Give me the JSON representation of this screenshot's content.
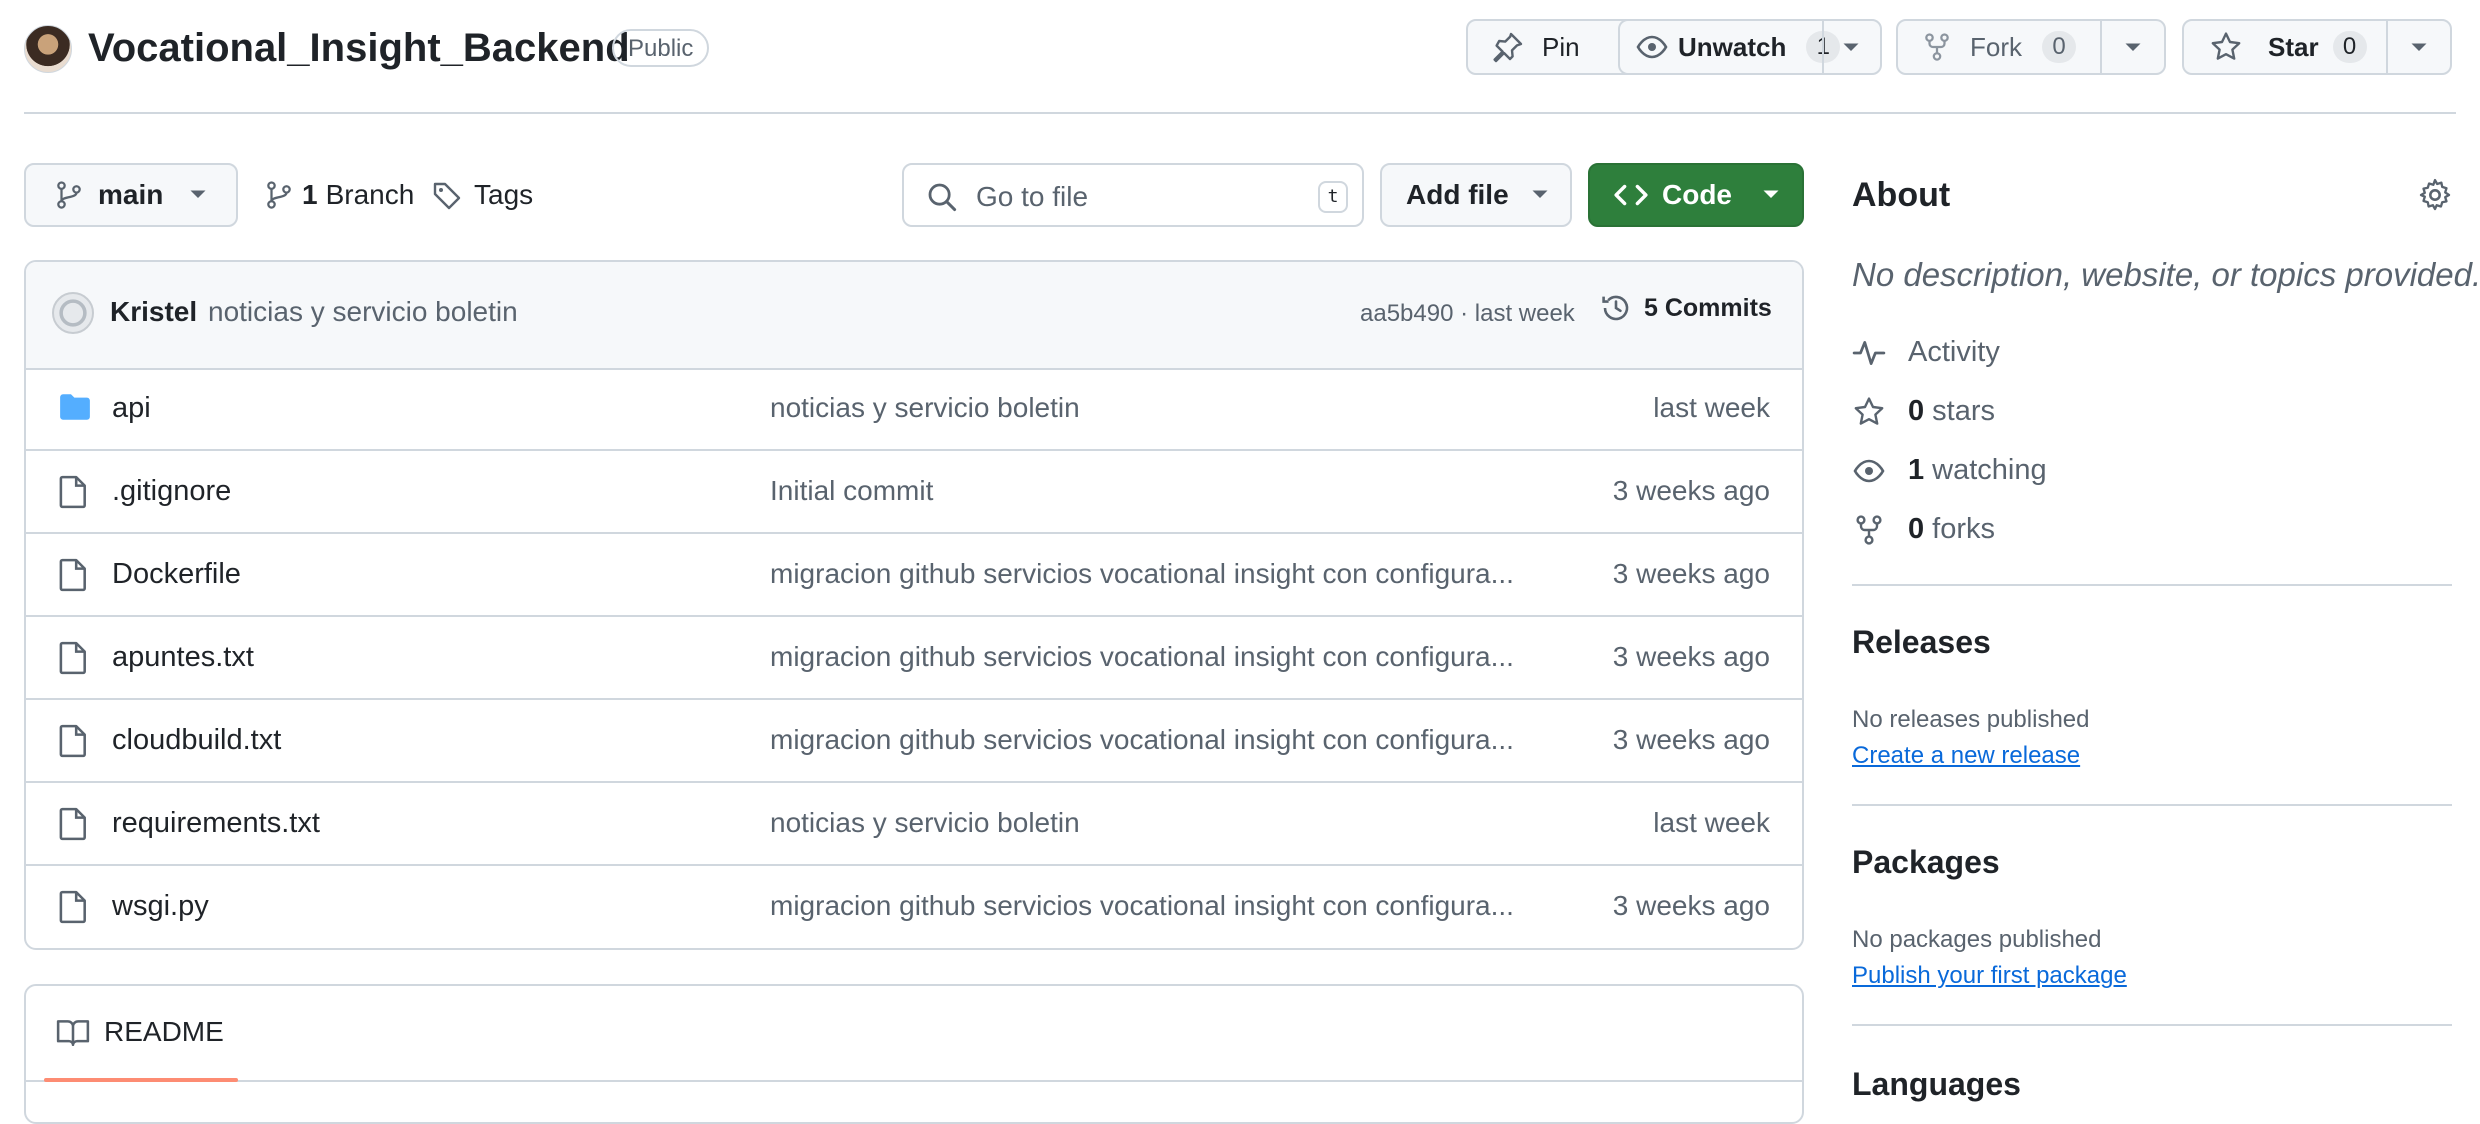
{
  "repo": {
    "name": "Vocational_Insight_Backend",
    "visibility": "Public"
  },
  "actions": {
    "pin": "Pin",
    "unwatch": "Unwatch",
    "unwatch_count": "1",
    "fork": "Fork",
    "fork_count": "0",
    "star": "Star",
    "star_count": "0"
  },
  "toolbar": {
    "branch": "main",
    "branch_count": "1",
    "branch_label": "Branch",
    "tags_label": "Tags",
    "search_placeholder": "Go to file",
    "search_shortcut": "t",
    "add_file": "Add file",
    "code": "Code"
  },
  "latest_commit": {
    "author": "Kristel",
    "message": "noticias y servicio boletin",
    "sha_time": "aa5b490 · last week",
    "commits_label": "5 Commits"
  },
  "files": [
    {
      "name": "api",
      "type": "folder",
      "commit": "noticias y servicio boletin",
      "time": "last week"
    },
    {
      "name": ".gitignore",
      "type": "file",
      "commit": "Initial commit",
      "time": "3 weeks ago"
    },
    {
      "name": "Dockerfile",
      "type": "file",
      "commit": "migracion github servicios vocational insight con configura...",
      "time": "3 weeks ago"
    },
    {
      "name": "apuntes.txt",
      "type": "file",
      "commit": "migracion github servicios vocational insight con configura...",
      "time": "3 weeks ago"
    },
    {
      "name": "cloudbuild.txt",
      "type": "file",
      "commit": "migracion github servicios vocational insight con configura...",
      "time": "3 weeks ago"
    },
    {
      "name": "requirements.txt",
      "type": "file",
      "commit": "noticias y servicio boletin",
      "time": "last week"
    },
    {
      "name": "wsgi.py",
      "type": "file",
      "commit": "migracion github servicios vocational insight con configura...",
      "time": "3 weeks ago"
    }
  ],
  "readme": {
    "tab": "README"
  },
  "about": {
    "title": "About",
    "description": "No description, website, or topics provided.",
    "activity": "Activity",
    "stars_count": "0",
    "stars_label": "stars",
    "watching_count": "1",
    "watching_label": "watching",
    "forks_count": "0",
    "forks_label": "forks"
  },
  "releases": {
    "title": "Releases",
    "status": "No releases published",
    "link": "Create a new release"
  },
  "packages": {
    "title": "Packages",
    "status": "No packages published",
    "link": "Publish your first package"
  },
  "languages": {
    "title": "Languages"
  },
  "colors": {
    "accent_green": "#2e7f3c",
    "link_blue": "#0969da",
    "folder_blue": "#54aeff",
    "readme_underline": "#fd8c73"
  }
}
